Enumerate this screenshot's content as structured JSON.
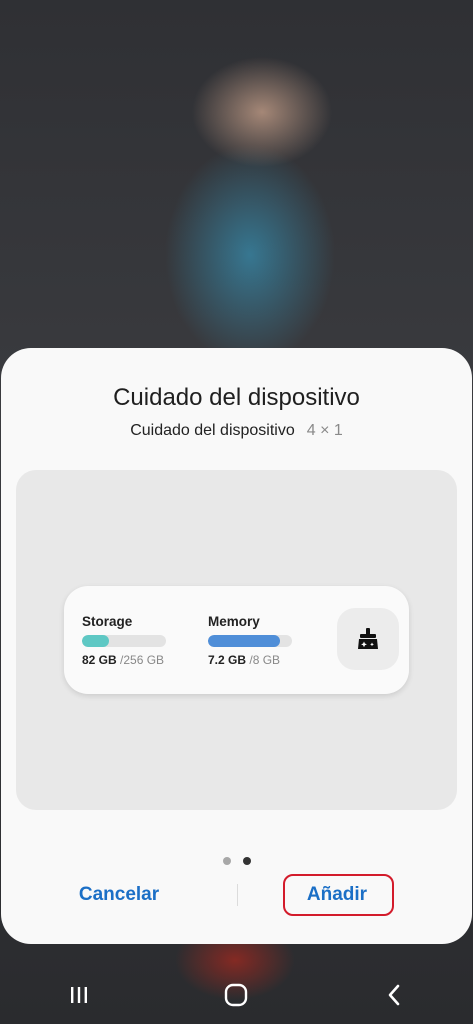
{
  "sheet": {
    "title": "Cuidado del dispositivo",
    "widget_name": "Cuidado del dispositivo",
    "widget_size": "4 × 1"
  },
  "widget": {
    "storage": {
      "label": "Storage",
      "used": "82 GB",
      "total": "/256 GB",
      "fill_fraction": 0.32,
      "color": "#5ec8c4"
    },
    "memory": {
      "label": "Memory",
      "used": "7.2 GB",
      "total": "/8 GB",
      "fill_fraction": 0.86,
      "color": "#4f8ed8"
    },
    "clean_icon": "broom-sparkle-icon"
  },
  "pager": {
    "count": 2,
    "active_index": 1,
    "active_color": "#333333",
    "inactive_color": "#a8a8a8"
  },
  "actions": {
    "cancel_label": "Cancelar",
    "add_label": "Añadir",
    "accent_color": "#1b6fc6",
    "highlight_color": "#d31b2b"
  },
  "navbar": {
    "recents_icon": "recents-icon",
    "home_icon": "home-icon",
    "back_icon": "back-icon"
  }
}
